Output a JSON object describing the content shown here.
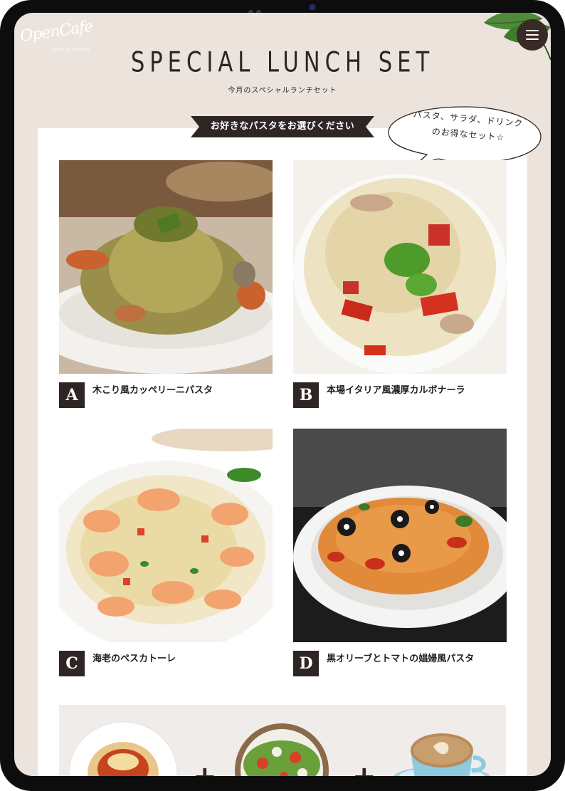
{
  "logo": {
    "name": "OpenCafe",
    "tagline": "— dish & coffee"
  },
  "header": {
    "title": "SPECIAL LUNCH SET",
    "subtitle": "今月のスペシャルランチセット",
    "menu_icon": "hamburger-icon"
  },
  "selection": {
    "ribbon_label": "お好きなパスタをお選びください",
    "bubble_line1": "パスタ、サラダ、ドリンク",
    "bubble_line2": "のお得なセット☆"
  },
  "pastas": [
    {
      "letter": "A",
      "name": "木こり風カッペリーニパスタ"
    },
    {
      "letter": "B",
      "name": "本場イタリア風濃厚カルボナーラ"
    },
    {
      "letter": "C",
      "name": "海老のペスカトーレ"
    },
    {
      "letter": "D",
      "name": "黒オリーブとトマトの娼婦風パスタ"
    }
  ],
  "set_bar": {
    "plus_1": "+",
    "plus_2": "+"
  },
  "colors": {
    "background": "#ece3dc",
    "dark": "#2d2624",
    "panel": "#ffffff",
    "menu_button": "#3a2a26"
  }
}
